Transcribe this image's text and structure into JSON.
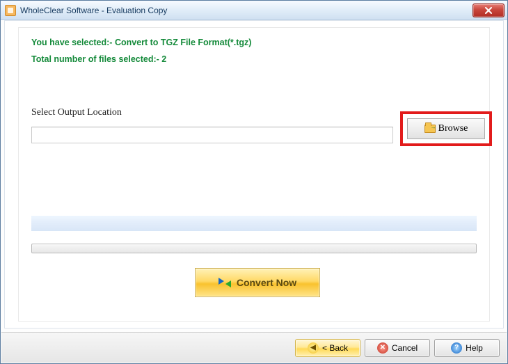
{
  "window": {
    "title": "WholeClear Software - Evaluation Copy"
  },
  "status": {
    "line1": "You have selected:- Convert to TGZ File Format(*.tgz)",
    "line2": "Total number of files selected:- 2"
  },
  "output": {
    "label": "Select Output Location",
    "value": "",
    "browse_label": "Browse"
  },
  "convert": {
    "label": "Convert Now"
  },
  "footer": {
    "back": "< Back",
    "cancel": "Cancel",
    "help": "Help"
  }
}
